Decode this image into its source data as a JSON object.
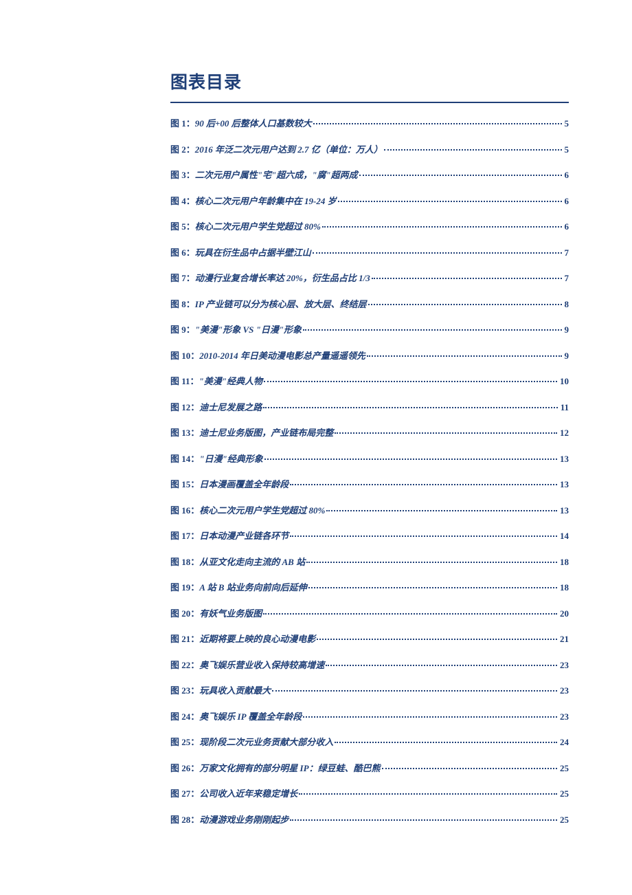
{
  "title": "图表目录",
  "entries": [
    {
      "prefix": "图 1：",
      "label": "90 后+00 后整体人口基数较大",
      "page": "5"
    },
    {
      "prefix": "图 2：",
      "label": "2016 年泛二次元用户达到 2.7 亿（单位：万人）",
      "page": "5"
    },
    {
      "prefix": "图 3：",
      "label": "二次元用户属性\"宅\"超六成，\"腐\"超两成",
      "page": "6"
    },
    {
      "prefix": "图 4：",
      "label": "核心二次元用户年龄集中在 19-24 岁",
      "page": "6"
    },
    {
      "prefix": "图 5：",
      "label": "核心二次元用户学生党超过 80%",
      "page": "6"
    },
    {
      "prefix": "图 6：",
      "label": "玩具在衍生品中占据半壁江山",
      "page": "7"
    },
    {
      "prefix": "图 7：",
      "label": "动漫行业复合增长率达 20%，衍生品占比 1/3",
      "page": "7"
    },
    {
      "prefix": "图 8：",
      "label": "IP 产业链可以分为核心层、放大层、终结层",
      "page": "8"
    },
    {
      "prefix": "图 9：",
      "label": "\"美漫\"形象 VS \"日漫\"形象",
      "page": "9"
    },
    {
      "prefix": "图 10：",
      "label": "2010-2014 年日美动漫电影总产量遥遥领先",
      "page": "9"
    },
    {
      "prefix": "图 11：",
      "label": "\"美漫\"经典人物",
      "page": "10"
    },
    {
      "prefix": "图 12：",
      "label": "迪士尼发展之路",
      "page": "11"
    },
    {
      "prefix": "图 13：",
      "label": "迪士尼业务版图，产业链布局完整",
      "page": "12"
    },
    {
      "prefix": "图 14：",
      "label": "\"日漫\"经典形象",
      "page": "13"
    },
    {
      "prefix": "图 15：",
      "label": "日本漫画覆盖全年龄段",
      "page": "13"
    },
    {
      "prefix": "图 16：",
      "label": "核心二次元用户学生党超过 80%",
      "page": "13"
    },
    {
      "prefix": "图 17：",
      "label": "日本动漫产业链各环节",
      "page": "14"
    },
    {
      "prefix": "图 18：",
      "label": "从亚文化走向主流的 AB 站",
      "page": "18"
    },
    {
      "prefix": "图 19：",
      "label": "A 站 B 站业务向前向后延伸",
      "page": "18"
    },
    {
      "prefix": "图 20：",
      "label": "有妖气业务版图",
      "page": "20"
    },
    {
      "prefix": "图 21：",
      "label": "近期将要上映的良心动漫电影",
      "page": "21"
    },
    {
      "prefix": "图 22：",
      "label": "奥飞娱乐营业收入保持较高增速",
      "page": "23"
    },
    {
      "prefix": "图 23：",
      "label": "玩具收入贡献最大",
      "page": "23"
    },
    {
      "prefix": "图 24：",
      "label": "奥飞娱乐 IP 覆盖全年龄段",
      "page": "23"
    },
    {
      "prefix": "图 25：",
      "label": "现阶段二次元业务贡献大部分收入",
      "page": "24"
    },
    {
      "prefix": "图 26：",
      "label": "万家文化拥有的部分明星 IP：绿豆蛙、酷巴熊",
      "page": "25"
    },
    {
      "prefix": "图 27：",
      "label": "公司收入近年来稳定增长",
      "page": "25"
    },
    {
      "prefix": "图 28：",
      "label": "动漫游戏业务刚刚起步",
      "page": "25"
    }
  ]
}
